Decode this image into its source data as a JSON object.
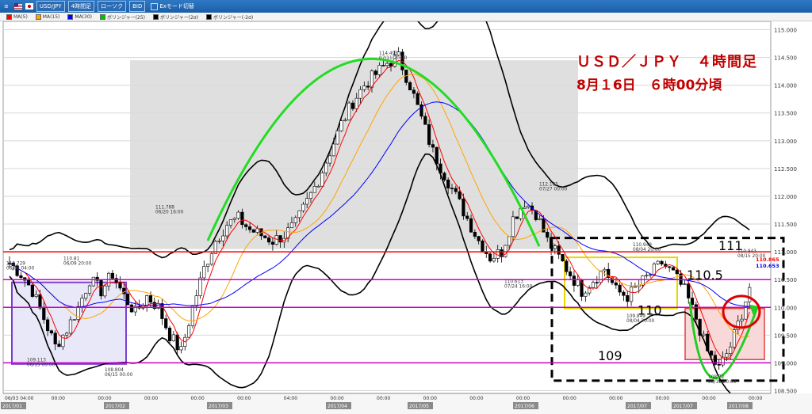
{
  "toolbar": {
    "pair": "USD/JPY",
    "timeframe": "4時間足",
    "chart_type": "ローソク",
    "price_side": "BID",
    "mode": "Exモード切替"
  },
  "legend": [
    {
      "label": "MA(5)",
      "color": "#ff0000"
    },
    {
      "label": "MA(15)",
      "color": "#ffa500"
    },
    {
      "label": "MA(30)",
      "color": "#0000ff"
    },
    {
      "label": "ボリンジャー(25)",
      "color": "#00c000"
    },
    {
      "label": "ボリンジャー(2σ)",
      "color": "#000000"
    },
    {
      "label": "ボリンジャー(-2σ)",
      "color": "#000000"
    }
  ],
  "headline": {
    "title": "ＵＳＤ／ＪＰＹ　４時間足",
    "subtitle": "8月１6日　６時00分頃"
  },
  "chart_data": {
    "type": "candlestick",
    "ylim": [
      108.45,
      115.15
    ],
    "y_ticks": [
      "115.000",
      "114.500",
      "114.000",
      "113.500",
      "113.000",
      "112.500",
      "112.000",
      "111.500",
      "111.000",
      "110.500",
      "110.000",
      "109.500",
      "109.000",
      "108.500"
    ],
    "x_ticks": [
      "06/03 04:00",
      "00:00",
      "00:00",
      "00:00",
      "00:00",
      "00:00",
      "04:00",
      "00:00",
      "00:00",
      "00:00",
      "00:00",
      "00:00",
      "00:00",
      "00:00",
      "00:00",
      "00:00",
      "00:00"
    ],
    "month_labels": [
      "2017/01",
      "2017/02",
      "2017/03",
      "2017/04",
      "2017/05",
      "2017/06",
      "2017/07",
      "2017/07",
      "2017/08"
    ],
    "close_path": [
      110.8,
      110.6,
      110.3,
      109.8,
      109.3,
      109.6,
      110.0,
      110.5,
      110.3,
      110.6,
      110.2,
      109.9,
      110.2,
      110.0,
      109.5,
      109.2,
      110.0,
      110.7,
      111.2,
      111.5,
      111.6,
      111.4,
      111.3,
      111.2,
      111.3,
      111.5,
      111.9,
      112.3,
      112.8,
      113.3,
      113.7,
      114.0,
      114.2,
      114.4,
      114.5,
      114.0,
      113.4,
      112.8,
      112.4,
      112.0,
      111.6,
      111.2,
      110.9,
      111.0,
      111.6,
      111.9,
      111.7,
      111.2,
      110.9,
      110.6,
      110.3,
      110.5,
      110.7,
      110.3,
      110.2,
      110.4,
      110.6,
      110.8,
      110.6,
      110.3,
      109.8,
      109.2,
      108.9,
      109.3,
      109.9,
      110.6
    ],
    "horizontal_lines": [
      {
        "value": 111.0,
        "color": "#ff0000"
      },
      {
        "value": 110.5,
        "color": "#cc00cc"
      },
      {
        "value": 110.0,
        "color": "#cc00cc"
      },
      {
        "value": 109.0,
        "color": "#cc00cc"
      }
    ],
    "price_tags": [
      {
        "value": "110.865",
        "color": "#ff0000"
      },
      {
        "value": "110.653",
        "color": "#0000ff"
      }
    ],
    "annotations": [
      {
        "text": "110.729",
        "sub": "06/03 04:00"
      },
      {
        "text": "110.81",
        "sub": "06/09 20:00"
      },
      {
        "text": "109.113",
        "sub": "06/15 00:00"
      },
      {
        "text": "108.804",
        "sub": "06/15 00:00"
      },
      {
        "text": "111.788",
        "sub": "06/20 16:00"
      },
      {
        "text": "114.493",
        "sub": "07/11 20:00"
      },
      {
        "text": "112.185",
        "sub": "07/27 00:00"
      },
      {
        "text": "110.613",
        "sub": "07/24 16:00"
      },
      {
        "text": "110.949",
        "sub": "08/04 20:00"
      },
      {
        "text": "109.849",
        "sub": "08/04 20:00"
      },
      {
        "text": "110.943",
        "sub": "08/15 20:00"
      },
      {
        "text": "108.72",
        "sub": "08/11 20:00"
      }
    ],
    "level_labels": [
      "111",
      "110.5",
      "110",
      "109"
    ]
  }
}
